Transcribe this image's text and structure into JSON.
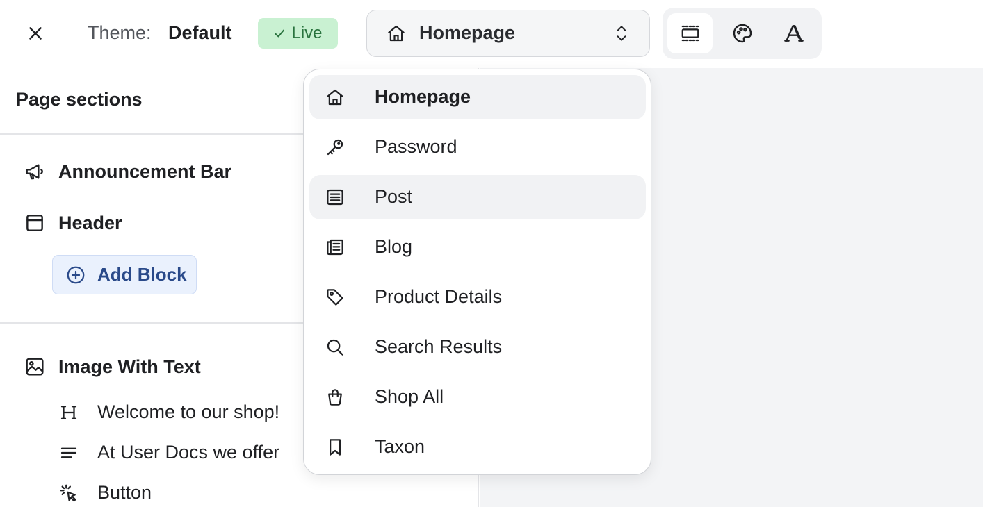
{
  "topbar": {
    "theme_label": "Theme:",
    "theme_name": "Default",
    "status_badge": "Live",
    "page_select_value": "Homepage"
  },
  "left_panel": {
    "title": "Page sections",
    "sections": [
      {
        "label": "Announcement Bar",
        "icon": "megaphone-icon"
      },
      {
        "label": "Header",
        "icon": "window-icon"
      }
    ],
    "add_block_label": "Add Block",
    "section3": {
      "label": "Image With Text",
      "icon": "image-icon"
    },
    "blocks": [
      {
        "label": "Welcome to our shop!",
        "icon": "heading-icon"
      },
      {
        "label": "At User Docs we offer",
        "icon": "text-icon"
      },
      {
        "label": "Button",
        "icon": "pointer-click-icon"
      }
    ]
  },
  "dropdown": {
    "items": [
      {
        "label": "Homepage",
        "icon": "home-icon",
        "selected": true
      },
      {
        "label": "Password",
        "icon": "key-icon"
      },
      {
        "label": "Post",
        "icon": "document-icon",
        "hovered": true
      },
      {
        "label": "Blog",
        "icon": "newspaper-icon"
      },
      {
        "label": "Product Details",
        "icon": "tag-icon"
      },
      {
        "label": "Search Results",
        "icon": "search-icon"
      },
      {
        "label": "Shop All",
        "icon": "shopping-bag-icon"
      },
      {
        "label": "Taxon",
        "icon": "bookmark-icon"
      }
    ]
  },
  "colors": {
    "live_badge_bg": "#c9f1d2",
    "live_badge_text": "#29733e",
    "add_block_bg": "#eaf1fd",
    "add_block_text": "#2a4a8a",
    "canvas_bg": "#f3f4f6"
  }
}
